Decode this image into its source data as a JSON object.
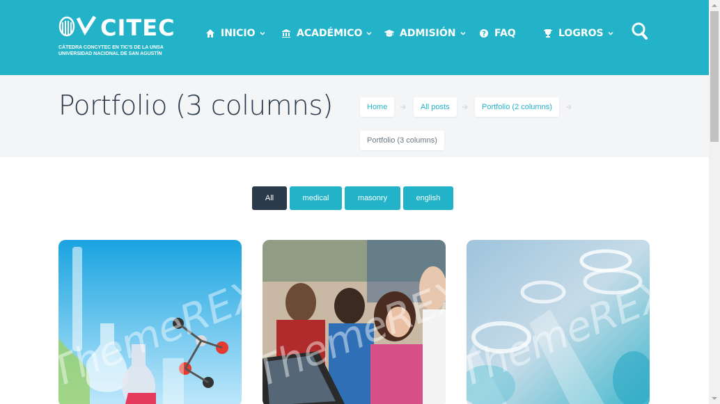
{
  "header": {
    "logo_text": "CITEC",
    "logo_sub_1": "CÁTEDRA CONCYTEC EN TIC'S DE LA UNSA",
    "logo_sub_2": "UNIVERSIDAD NACIONAL DE SAN AGUSTÍN",
    "nav": [
      {
        "label": "INICIO",
        "icon": "home-icon"
      },
      {
        "label": "ACADÉMICO",
        "icon": "bank-icon"
      },
      {
        "label": "ADMISIÓN",
        "icon": "graduation-cap-icon"
      },
      {
        "label": "FAQ",
        "icon": "question-circle-icon"
      },
      {
        "label": "LOGROS",
        "icon": "trophy-icon"
      }
    ]
  },
  "page": {
    "title": "Portfolio (3 columns)"
  },
  "breadcrumb": [
    "Home",
    "All posts",
    "Portfolio (2 columns)",
    "Portfolio (3 columns)"
  ],
  "filters": [
    "All",
    "medical",
    "masonry",
    "english"
  ],
  "portfolio": {
    "items": [
      {
        "image": "laboratory flasks and molecule model",
        "watermark": "ThemeREX"
      },
      {
        "image": "students working on laptops",
        "watermark": "ThemeREX"
      },
      {
        "image": "glass test tubes",
        "watermark": "ThemeREX"
      }
    ]
  },
  "colors": {
    "accent": "#22b3c8",
    "dark": "#2b3a4a",
    "band": "#f3f5f7"
  }
}
